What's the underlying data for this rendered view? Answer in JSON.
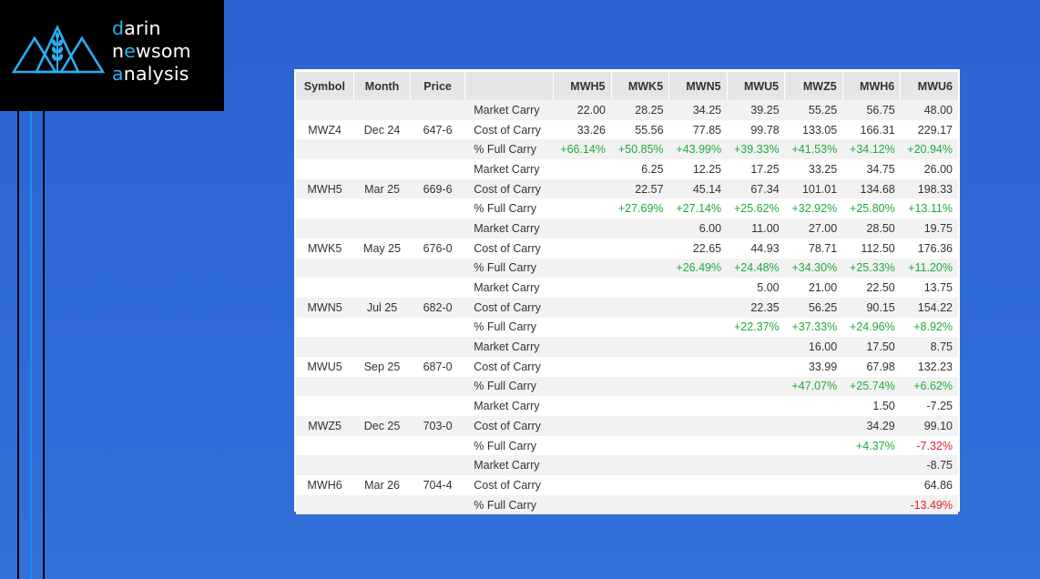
{
  "brand": {
    "line1": {
      "accent": "d",
      "rest": "arin"
    },
    "line2": {
      "pre": "n",
      "accent": "e",
      "mid": "w",
      "rest": "som"
    },
    "line3": {
      "accent": "a",
      "rest": "nalysis"
    }
  },
  "colors": {
    "accent": "#2ab0f0",
    "positive": "#1eab3a",
    "negative": "#e0202f",
    "background": "#2f6bd7"
  },
  "icons": [
    "mountain-wheat-logo-icon"
  ],
  "table": {
    "headers": [
      "Symbol",
      "Month",
      "Price",
      "",
      "MWH5",
      "MWK5",
      "MWN5",
      "MWU5",
      "MWZ5",
      "MWH6",
      "MWU6"
    ],
    "rows": [
      {
        "symbol": "",
        "month": "",
        "price": "",
        "type": "Market Carry",
        "values": [
          "22.00",
          "28.25",
          "34.25",
          "39.25",
          "55.25",
          "56.75",
          "48.00"
        ]
      },
      {
        "symbol": "MWZ4",
        "month": "Dec 24",
        "price": "647-6",
        "type": "Cost of Carry",
        "values": [
          "33.26",
          "55.56",
          "77.85",
          "99.78",
          "133.05",
          "166.31",
          "229.17"
        ]
      },
      {
        "symbol": "",
        "month": "",
        "price": "",
        "type": "% Full Carry",
        "values": [
          "+66.14%",
          "+50.85%",
          "+43.99%",
          "+39.33%",
          "+41.53%",
          "+34.12%",
          "+20.94%"
        ]
      },
      {
        "symbol": "",
        "month": "",
        "price": "",
        "type": "Market Carry",
        "values": [
          "",
          "6.25",
          "12.25",
          "17.25",
          "33.25",
          "34.75",
          "26.00"
        ]
      },
      {
        "symbol": "MWH5",
        "month": "Mar 25",
        "price": "669-6",
        "type": "Cost of Carry",
        "values": [
          "",
          "22.57",
          "45.14",
          "67.34",
          "101.01",
          "134.68",
          "198.33"
        ]
      },
      {
        "symbol": "",
        "month": "",
        "price": "",
        "type": "% Full Carry",
        "values": [
          "",
          "+27.69%",
          "+27.14%",
          "+25.62%",
          "+32.92%",
          "+25.80%",
          "+13.11%"
        ]
      },
      {
        "symbol": "",
        "month": "",
        "price": "",
        "type": "Market Carry",
        "values": [
          "",
          "",
          "6.00",
          "11.00",
          "27.00",
          "28.50",
          "19.75"
        ]
      },
      {
        "symbol": "MWK5",
        "month": "May 25",
        "price": "676-0",
        "type": "Cost of Carry",
        "values": [
          "",
          "",
          "22.65",
          "44.93",
          "78.71",
          "112.50",
          "176.36"
        ]
      },
      {
        "symbol": "",
        "month": "",
        "price": "",
        "type": "% Full Carry",
        "values": [
          "",
          "",
          "+26.49%",
          "+24.48%",
          "+34.30%",
          "+25.33%",
          "+11.20%"
        ]
      },
      {
        "symbol": "",
        "month": "",
        "price": "",
        "type": "Market Carry",
        "values": [
          "",
          "",
          "",
          "5.00",
          "21.00",
          "22.50",
          "13.75"
        ]
      },
      {
        "symbol": "MWN5",
        "month": "Jul 25",
        "price": "682-0",
        "type": "Cost of Carry",
        "values": [
          "",
          "",
          "",
          "22.35",
          "56.25",
          "90.15",
          "154.22"
        ]
      },
      {
        "symbol": "",
        "month": "",
        "price": "",
        "type": "% Full Carry",
        "values": [
          "",
          "",
          "",
          "+22.37%",
          "+37.33%",
          "+24.96%",
          "+8.92%"
        ]
      },
      {
        "symbol": "",
        "month": "",
        "price": "",
        "type": "Market Carry",
        "values": [
          "",
          "",
          "",
          "",
          "16.00",
          "17.50",
          "8.75"
        ]
      },
      {
        "symbol": "MWU5",
        "month": "Sep 25",
        "price": "687-0",
        "type": "Cost of Carry",
        "values": [
          "",
          "",
          "",
          "",
          "33.99",
          "67.98",
          "132.23"
        ]
      },
      {
        "symbol": "",
        "month": "",
        "price": "",
        "type": "% Full Carry",
        "values": [
          "",
          "",
          "",
          "",
          "+47.07%",
          "+25.74%",
          "+6.62%"
        ]
      },
      {
        "symbol": "",
        "month": "",
        "price": "",
        "type": "Market Carry",
        "values": [
          "",
          "",
          "",
          "",
          "",
          "1.50",
          "-7.25"
        ]
      },
      {
        "symbol": "MWZ5",
        "month": "Dec 25",
        "price": "703-0",
        "type": "Cost of Carry",
        "values": [
          "",
          "",
          "",
          "",
          "",
          "34.29",
          "99.10"
        ]
      },
      {
        "symbol": "",
        "month": "",
        "price": "",
        "type": "% Full Carry",
        "values": [
          "",
          "",
          "",
          "",
          "",
          "+4.37%",
          "-7.32%"
        ]
      },
      {
        "symbol": "",
        "month": "",
        "price": "",
        "type": "Market Carry",
        "values": [
          "",
          "",
          "",
          "",
          "",
          "",
          "-8.75"
        ]
      },
      {
        "symbol": "MWH6",
        "month": "Mar 26",
        "price": "704-4",
        "type": "Cost of Carry",
        "values": [
          "",
          "",
          "",
          "",
          "",
          "",
          "64.86"
        ]
      },
      {
        "symbol": "",
        "month": "",
        "price": "",
        "type": "% Full Carry",
        "values": [
          "",
          "",
          "",
          "",
          "",
          "",
          "-13.49%"
        ]
      }
    ]
  }
}
